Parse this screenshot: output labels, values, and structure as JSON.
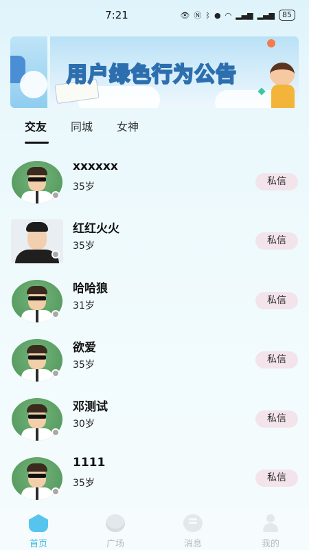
{
  "status_bar": {
    "time": "7:21",
    "icons": [
      "eye-icon",
      "nfc-icon",
      "bluetooth-icon",
      "location-icon",
      "wifi-icon",
      "signal-4g-icon",
      "signal-4g-icon"
    ],
    "signal1": "⁴ᴳ",
    "signal2": "⁴ᴳ",
    "battery": "85"
  },
  "banner": {
    "title": "用户绿色行为公告"
  },
  "tabs": [
    {
      "label": "交友",
      "active": true
    },
    {
      "label": "同城",
      "active": false
    },
    {
      "label": "女神",
      "active": false
    }
  ],
  "users": [
    {
      "name": "xxxxxx",
      "age": "35岁",
      "avatar": "cartoon",
      "action": "私信"
    },
    {
      "name": "红红火火",
      "age": "35岁",
      "avatar": "photo",
      "action": "私信"
    },
    {
      "name": "哈哈狼",
      "age": "31岁",
      "avatar": "cartoon",
      "action": "私信"
    },
    {
      "name": "欲爱",
      "age": "35岁",
      "avatar": "cartoon",
      "action": "私信"
    },
    {
      "name": "邓测试",
      "age": "30岁",
      "avatar": "cartoon",
      "action": "私信"
    },
    {
      "name": "1111",
      "age": "35岁",
      "avatar": "cartoon",
      "action": "私信"
    }
  ],
  "bottom_nav": [
    {
      "label": "首页",
      "icon": "home-icon",
      "active": true
    },
    {
      "label": "广场",
      "icon": "planet-icon",
      "active": false
    },
    {
      "label": "消息",
      "icon": "message-icon",
      "active": false
    },
    {
      "label": "我的",
      "icon": "user-icon",
      "active": false
    }
  ],
  "colors": {
    "accent": "#37b8e5",
    "message_button_bg": "#f3e3ea",
    "offline_dot": "#a9a9a9"
  }
}
